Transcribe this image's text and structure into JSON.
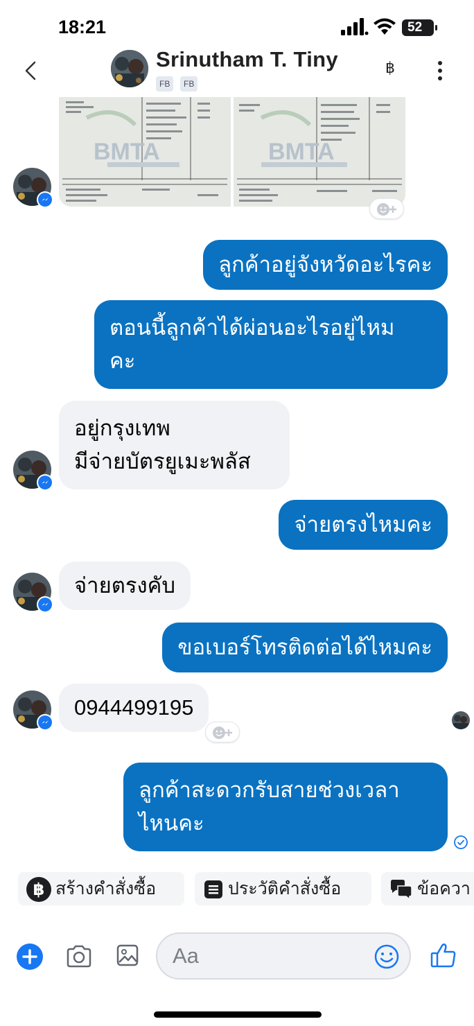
{
  "status_bar": {
    "time": "18:21",
    "battery": "52"
  },
  "header": {
    "contact_name": "Srinutham T. Tiny",
    "tags": [
      "FB",
      "FB"
    ]
  },
  "messages": [
    {
      "side": "out",
      "text": "ลูกค้าอยู่จังหวัดอะไรคะ"
    },
    {
      "side": "out",
      "lines": [
        "ตอนนี้ลูกค้าได้ผ่อนอะไรอยู่ไหม",
        "คะ"
      ]
    },
    {
      "side": "in",
      "lines": [
        "อยู่กรุงเทพ",
        "มีจ่ายบัตรยูเมะพลัส"
      ]
    },
    {
      "side": "out",
      "text": "จ่ายตรงไหมคะ"
    },
    {
      "side": "in",
      "text": "จ่ายตรงคับ"
    },
    {
      "side": "out",
      "text": "ขอเบอร์โทรติดต่อได้ไหมคะ"
    },
    {
      "side": "in",
      "text": "0944499195"
    },
    {
      "side": "out",
      "lines": [
        "ลูกค้าสะดวกรับสายช่วงเวลา",
        "ไหนคะ"
      ]
    }
  ],
  "photos": {
    "watermark": "BMTA"
  },
  "quick_replies": [
    "สร้างคำสั่งซื้อ",
    "ประวัติคำสั่งซื้อ",
    "ข้อควา"
  ],
  "composer": {
    "placeholder": "Aa"
  },
  "icons": {
    "back": "chevron-left-icon",
    "baht": "baht-icon",
    "more": "more-vertical-icon",
    "plus": "plus-icon",
    "camera": "camera-icon",
    "gallery": "gallery-icon",
    "emoji": "emoji-icon",
    "like": "thumbs-up-icon"
  },
  "colors": {
    "outgoing_bubble": "#0a72c1",
    "incoming_bubble": "#f1f2f5",
    "accent": "#1877f2"
  }
}
